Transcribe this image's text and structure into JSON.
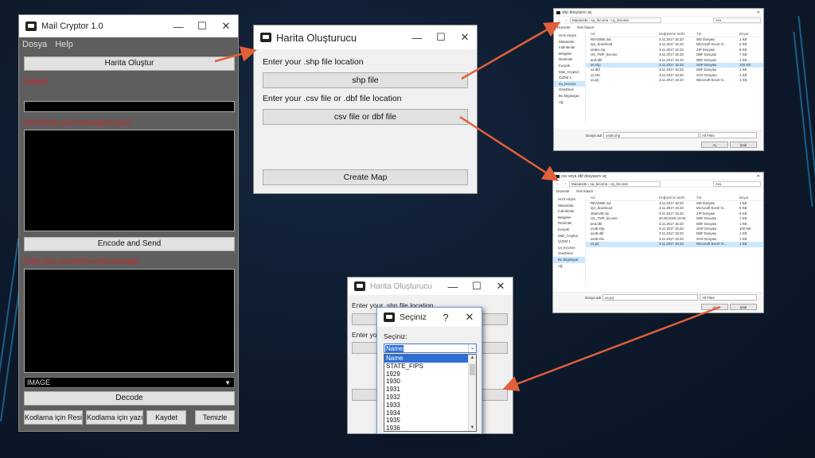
{
  "mail_cryptor": {
    "title": "Mail Cryptor 1.0",
    "menu": [
      "Dosya",
      "Help"
    ],
    "harita_button": "Harita Oluştur",
    "subject_label": "Subject:",
    "message_label": "Here Enter your message to send",
    "encode_button": "Encode and Send",
    "encoded_label": "Enter your encoded e-mail message",
    "format_select": "IMAGE",
    "decode_button": "Decode",
    "bottom_buttons": [
      "Kodlama için Resim Aç",
      "Kodlama için yazı Aç",
      "Kaydet",
      "Temizle"
    ]
  },
  "harita": {
    "title": "Harita Oluşturucu",
    "shp_label": "Enter your .shp file location",
    "shp_button": "shp file",
    "csv_label": "Enter your .csv file or .dbf file location",
    "csv_button": "csv file or dbf file",
    "create_button": "Create Map"
  },
  "file_dialog_shp": {
    "title": "shp dosyasını aç",
    "path": "Masaüstü › sa_lecome › üç_lecome",
    "search": "Ara",
    "cmd": [
      "Düzenle",
      "Yeni klasör"
    ],
    "nav": [
      "Hızlı erişim",
      "Masaüstü",
      "İndirilenler",
      "Belgeler",
      "Resimler",
      "Kuryak",
      "Mail_Cryptor",
      "ÇİZİM 1",
      "sa_lecome",
      "OneDrive",
      "Bu bilgisayar",
      "Ağ"
    ],
    "nav_selected": 8,
    "headers": [
      "Ad",
      "Değiştirme tarihi",
      "Tür",
      "Boyut"
    ],
    "files": [
      {
        "name": "README.md",
        "date": "3.11.2017 15:33",
        "type": "MD Dosyası",
        "size": "1 KB"
      },
      {
        "name": "sys_download",
        "date": "3.11.2017 15:33",
        "type": "Microsoft Excel Vi...",
        "size": "5 KB"
      },
      {
        "name": "states.zip",
        "date": "3.11.2017 15:33",
        "type": "ZIP Dosyası",
        "size": "8 KB"
      },
      {
        "name": "US_TMP_lecome",
        "date": "3.11.2017 15:33",
        "type": "DBF Dosyası",
        "size": "7 KB"
      },
      {
        "name": "and.dbf",
        "date": "3.11.2017 15:33",
        "type": "DBF Dosyası",
        "size": "1 KB"
      },
      {
        "name": "us.shp",
        "date": "3.11.2017 15:33",
        "type": "SHP Dosyası",
        "size": "100 KB"
      },
      {
        "name": "us.dbf",
        "date": "3.11.2017 15:33",
        "type": "DBF Dosyası",
        "size": "1 KB"
      },
      {
        "name": "us.shx",
        "date": "3.11.2017 15:33",
        "type": "SHX Dosyası",
        "size": "1 KB"
      },
      {
        "name": "us.prj",
        "date": "3.11.2017 15:33",
        "type": "Microsoft Excel Vi...",
        "size": "1 KB"
      }
    ],
    "selected_index": 5,
    "filename_label": "Dosya adı:",
    "filename": "us48.shp",
    "filter": "All Files",
    "open_button": "Aç",
    "cancel_button": "İptal"
  },
  "file_dialog_csv": {
    "title": "csv veya dbf dosyasını aç",
    "path": "Masaüstü › sa_lecome › üç_lecome",
    "search": "Ara",
    "cmd": [
      "Düzenle",
      "Yeni klasör"
    ],
    "nav": [
      "Hızlı erişim",
      "Masaüstü",
      "İndirilenler",
      "Belgeler",
      "Resimler",
      "Kuryak",
      "Mail_Cryptor",
      "ÇİZİM 1",
      "sa_lecome",
      "OneDrive",
      "Bu bilgisayar",
      "Ağ"
    ],
    "nav_selected": 10,
    "headers": [
      "Ad",
      "Değiştirme tarihi",
      "Tür",
      "Boyut"
    ],
    "files": [
      {
        "name": "README.md",
        "date": "3.11.2017 15:33",
        "type": "MD Dosyası",
        "size": "1 KB"
      },
      {
        "name": "sys_download",
        "date": "3.11.2017 15:33",
        "type": "Microsoft Excel Vi...",
        "size": "5 KB"
      },
      {
        "name": "states48.zip",
        "date": "3.11.2017 15:33",
        "type": "ZIP Dosyası",
        "size": "8 KB"
      },
      {
        "name": "US_TMP_lecome",
        "date": "20.09.2018 19:40",
        "type": "DBF Dosyası",
        "size": "7 KB"
      },
      {
        "name": "and.dbf",
        "date": "3.11.2017 15:33",
        "type": "DBF Dosyası",
        "size": "1 KB"
      },
      {
        "name": "us48.shp",
        "date": "3.11.2017 15:33",
        "type": "SHP Dosyası",
        "size": "100 KB"
      },
      {
        "name": "us48.dbf",
        "date": "3.11.2017 15:33",
        "type": "DBF Dosyası",
        "size": "1 KB"
      },
      {
        "name": "us48.shx",
        "date": "3.11.2017 15:33",
        "type": "SHX Dosyası",
        "size": "1 KB"
      },
      {
        "name": "us.prj",
        "date": "3.11.2017 15:33",
        "type": "Microsoft Excel Vi...",
        "size": "1 KB"
      }
    ],
    "selected_index": 8,
    "filename_label": "Dosya adı:",
    "filename": "us.prj",
    "filter": "All Files",
    "open_button": "Aç",
    "cancel_button": "İptal"
  },
  "harita_small": {
    "title": "Harita Oluşturucu",
    "shp_label": "Enter your .shp file location",
    "csv_label": "Enter you"
  },
  "seciniz": {
    "title": "Seçiniz",
    "help": "?",
    "close": "✕",
    "label": "Seçiniz:",
    "selected": "Name",
    "options": [
      "Name",
      "STATE_FIPS",
      "1929",
      "1930",
      "1931",
      "1932",
      "1933",
      "1934",
      "1935",
      "1936"
    ]
  },
  "colors": {
    "background": "#0d1a2c",
    "arrow": "#e0603a",
    "label_red": "#e02020",
    "selection_blue": "#2c6ed6"
  }
}
